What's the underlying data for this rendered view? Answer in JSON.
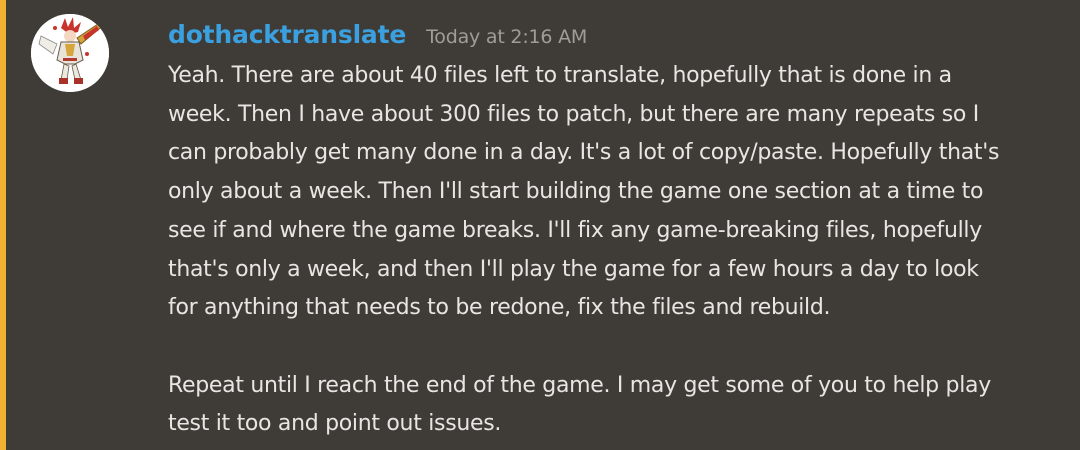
{
  "message": {
    "author": "dothacktranslate",
    "timestamp": "Today at 2:16 AM",
    "paragraph_1_lines": [
      "Yeah. There are about 40 files left to translate, hopefully that is done in a",
      "week. Then I have about 300 files to patch, but there are many repeats so I",
      "can probably get many done in a day. It's a lot of copy/paste. Hopefully that's",
      "only about a week. Then I'll start building the game one section at a time to",
      "see if and where the game breaks. I'll fix any game-breaking files, hopefully",
      "that's only a week, and then I'll play the game for a few hours a day to look",
      "for anything that needs to be redone, fix the files and rebuild."
    ],
    "paragraph_2_lines": [
      "Repeat until I reach the end of the game. I may get some of you to help play",
      "test it too and point out issues."
    ]
  },
  "colors": {
    "background": "#3f3c38",
    "accent_bar": "#f0b132",
    "username": "#3ba0df",
    "timestamp": "#a09d98",
    "text": "#e8e6e3"
  },
  "icons": {
    "avatar": "anime-character-avatar"
  }
}
